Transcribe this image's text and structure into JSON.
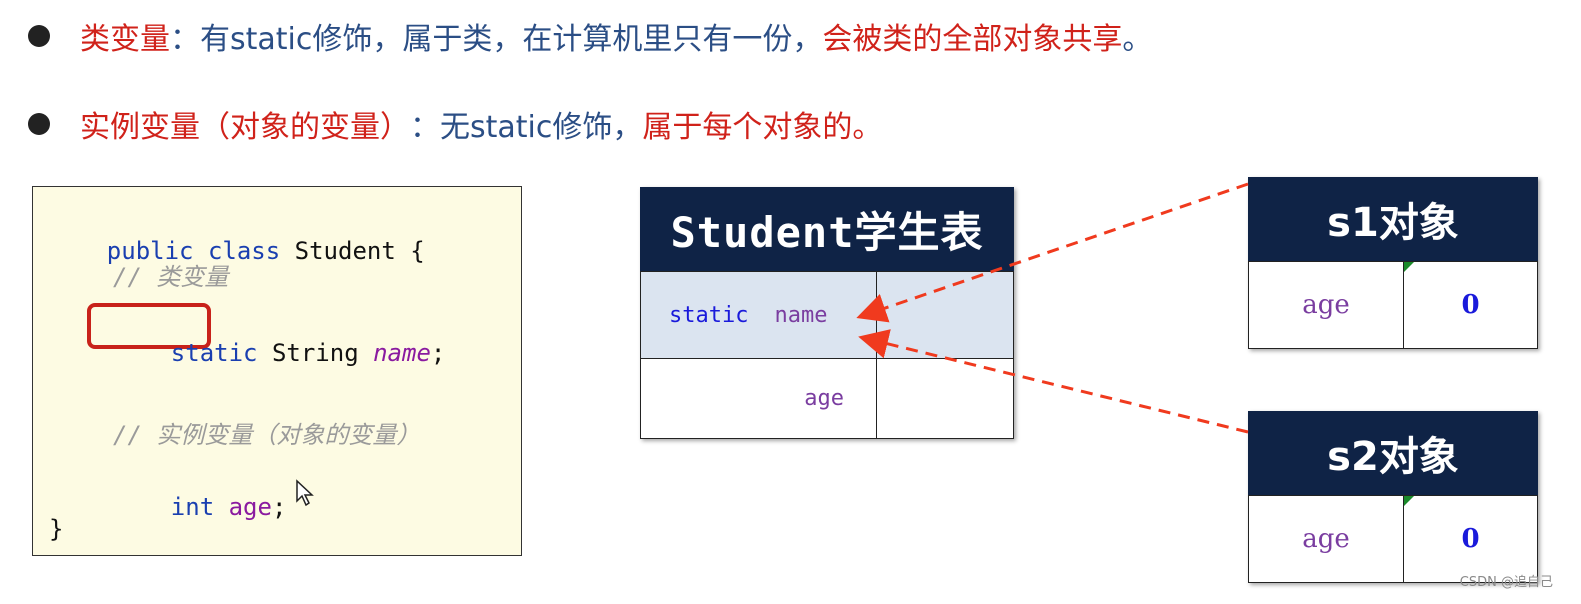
{
  "bullets": [
    {
      "term": "类变量",
      "colon": " ：",
      "desc": "有static修饰，属于类，在计算机里只有一份，",
      "highlight": "会被类的全部对象共享",
      "end": "。"
    },
    {
      "term": "实例变量（对象的变量）",
      "colon": "：",
      "desc": "无static修饰，",
      "highlight": "属于每个对象的",
      "end": "。"
    }
  ],
  "code": {
    "line1": {
      "kw1": "public",
      "kw2": "class",
      "name": "Student {"
    },
    "comment1": "// 类变量",
    "line3": {
      "kw": "static",
      "type": "String",
      "field": "name",
      "semi": ";"
    },
    "comment2": "// 实例变量（对象的变量）",
    "line5": {
      "kw": "int",
      "field": "age",
      "semi": ";"
    },
    "close": "}"
  },
  "student_table": {
    "title": "Student学生表",
    "rows": [
      {
        "modifier": "static",
        "field": "name"
      },
      {
        "field": "age"
      }
    ]
  },
  "objects": [
    {
      "title": "s1对象",
      "field": "age",
      "value": "0"
    },
    {
      "title": "s2对象",
      "field": "age",
      "value": "0"
    }
  ],
  "colors": {
    "accent_red": "#d0221a",
    "text_blue": "#2b4e85",
    "header_navy": "#0f2346",
    "arrow_red": "#f03a1e"
  },
  "watermark": "CSDN @追自己"
}
